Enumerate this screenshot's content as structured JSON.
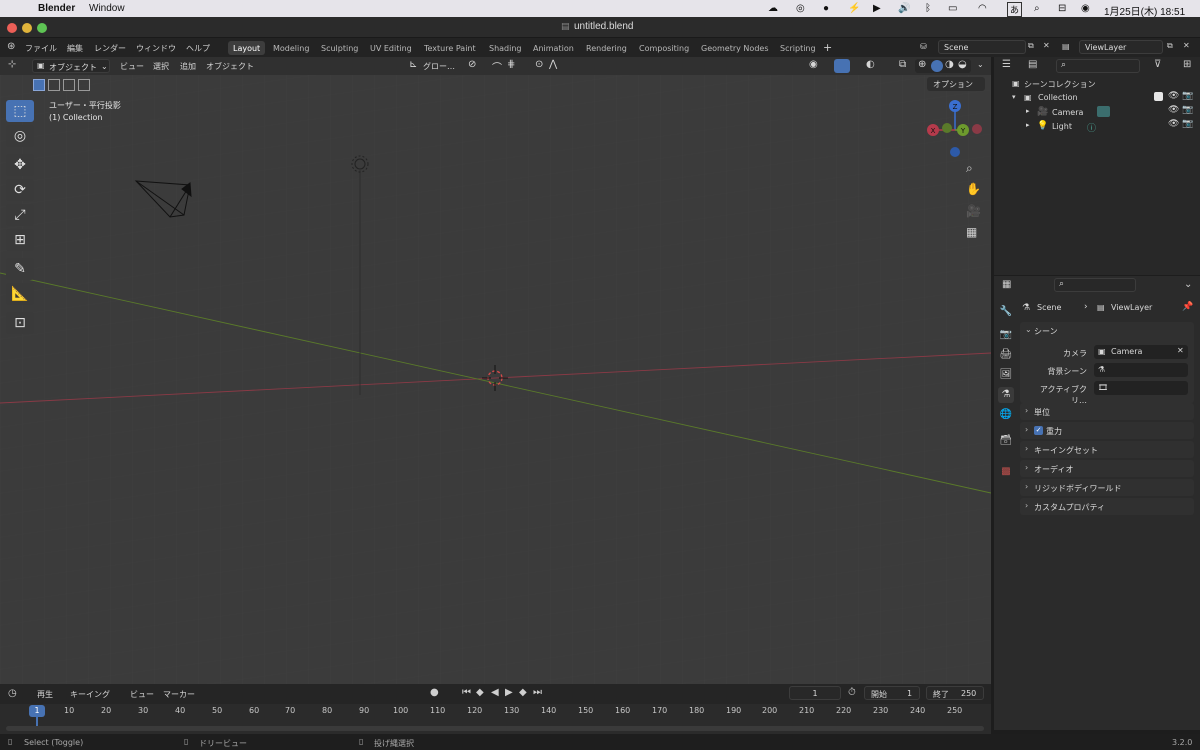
{
  "menubar": {
    "app": "Blender",
    "window_menu": "Window",
    "datetime": "1月25日(木)  18:51",
    "ime": "あ"
  },
  "titlebar": {
    "title": "untitled.blend"
  },
  "topbar": {
    "menus": [
      "ファイル",
      "編集",
      "レンダー",
      "ウィンドウ",
      "ヘルプ"
    ],
    "workspaces": [
      "Layout",
      "Modeling",
      "Sculpting",
      "UV Editing",
      "Texture Paint",
      "Shading",
      "Animation",
      "Rendering",
      "Compositing",
      "Geometry Nodes",
      "Scripting"
    ],
    "active_workspace": "Layout",
    "scene": "Scene",
    "view_layer": "ViewLayer"
  },
  "viewport_header": {
    "mode": "オブジェクト",
    "menus": [
      "ビュー",
      "選択",
      "追加",
      "オブジェクト"
    ],
    "transform_orientation": "グロー…",
    "options": "オプション"
  },
  "viewport": {
    "view_name": "ユーザー・平行投影",
    "collection_info": "(1) Collection"
  },
  "gizmo": {
    "x": "X",
    "y": "Y",
    "z": "Z"
  },
  "outliner": {
    "root": "シーンコレクション",
    "collection": "Collection",
    "items": [
      {
        "name": "Camera"
      },
      {
        "name": "Light"
      }
    ]
  },
  "properties": {
    "breadcrumb_scene": "Scene",
    "breadcrumb_layer": "ViewLayer",
    "scene_panel": "シーン",
    "camera_label": "カメラ",
    "camera_value": "Camera",
    "bg_scene_label": "背景シーン",
    "active_clip_label": "アクティブクリ…",
    "panels": [
      "単位",
      "重力",
      "キーイングセット",
      "オーディオ",
      "リジッドボディワールド",
      "カスタムプロパティ"
    ],
    "gravity_checked": true
  },
  "timeline": {
    "menus": [
      "再生",
      "キーイング",
      "ビュー",
      "マーカー"
    ],
    "current_frame": "1",
    "start_label": "開始",
    "start_value": "1",
    "end_label": "終了",
    "end_value": "250",
    "ruler": [
      "1",
      "10",
      "20",
      "30",
      "40",
      "50",
      "60",
      "70",
      "80",
      "90",
      "100",
      "110",
      "120",
      "130",
      "140",
      "150",
      "160",
      "170",
      "180",
      "190",
      "200",
      "210",
      "220",
      "230",
      "240",
      "250"
    ]
  },
  "statusbar": {
    "select": "Select (Toggle)",
    "pan": "ドリービュー",
    "lasso": "投げ縄選択",
    "version": "3.2.0"
  },
  "colors": {
    "accent": "#4772b3",
    "x_axis": "#b53a4b",
    "y_axis": "#6d9a2d",
    "z_axis": "#3a6fd1"
  }
}
